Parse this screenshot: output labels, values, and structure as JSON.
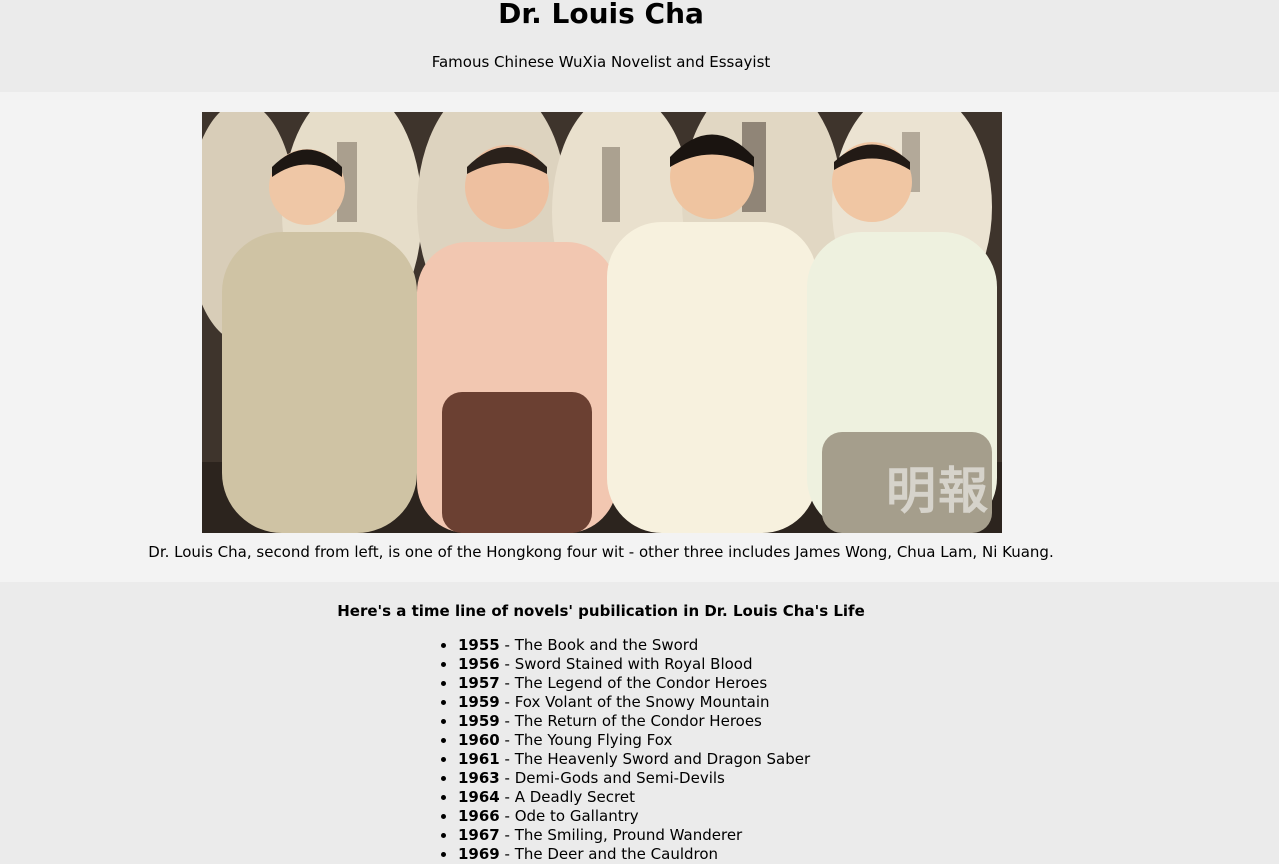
{
  "header": {
    "title": "Dr. Louis Cha",
    "subtitle": "Famous Chinese WuXia Novelist and Essayist"
  },
  "photo": {
    "watermark": "明報",
    "caption": "Dr. Louis Cha, second from left, is one of the Hongkong four wit - other three includes James Wong, Chua Lam, Ni Kuang."
  },
  "timeline": {
    "heading": "Here's a time line of novels' pubilication in Dr. Louis Cha's Life",
    "items": [
      {
        "year": "1955",
        "title": " - The Book and the Sword"
      },
      {
        "year": "1956",
        "title": " - Sword Stained with Royal Blood"
      },
      {
        "year": "1957",
        "title": " - The Legend of the Condor Heroes"
      },
      {
        "year": "1959",
        "title": " - Fox Volant of the Snowy Mountain"
      },
      {
        "year": "1959",
        "title": " - The Return of the Condor Heroes"
      },
      {
        "year": "1960",
        "title": " - The Young Flying Fox"
      },
      {
        "year": "1961",
        "title": " - The Heavenly Sword and Dragon Saber"
      },
      {
        "year": "1963",
        "title": " - Demi-Gods and Semi-Devils"
      },
      {
        "year": "1964",
        "title": " - A Deadly Secret"
      },
      {
        "year": "1966",
        "title": " - Ode to Gallantry"
      },
      {
        "year": "1967",
        "title": " - The Smiling, Pround Wanderer"
      },
      {
        "year": "1969",
        "title": " - The Deer and the Cauldron"
      }
    ]
  }
}
